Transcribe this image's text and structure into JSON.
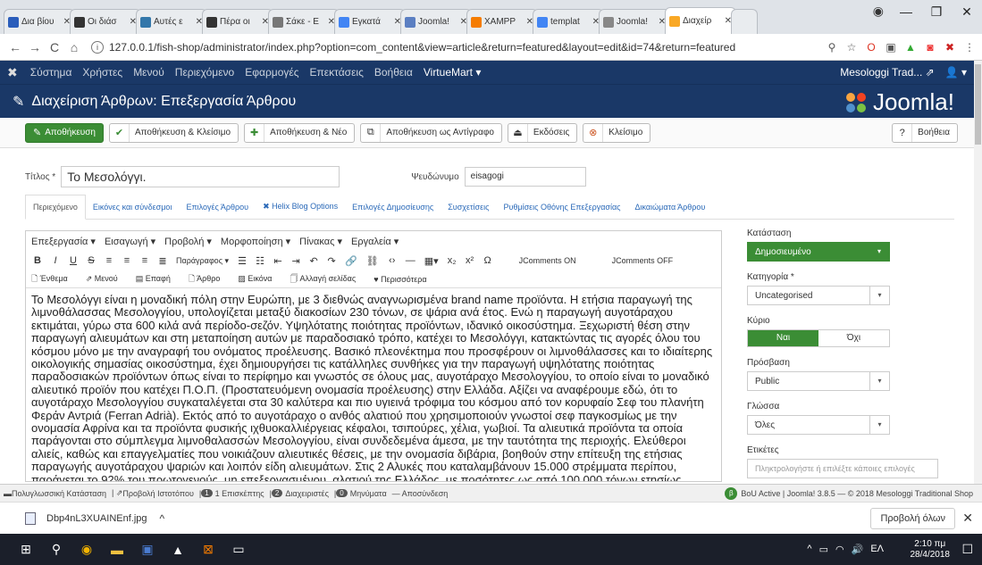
{
  "browser": {
    "tabs": [
      {
        "label": "Δια βίου",
        "color": "#2a5dbb"
      },
      {
        "label": "Οι διάσ",
        "color": "#333"
      },
      {
        "label": "Αυτές ε",
        "color": "#37a"
      },
      {
        "label": "Πέρα οι",
        "color": "#333"
      },
      {
        "label": "Σάκε - Ε",
        "color": "#777"
      },
      {
        "label": "Εγκατά",
        "color": "#4285f4"
      },
      {
        "label": "Joomla!",
        "color": "#5b7fc2"
      },
      {
        "label": "XAMPP",
        "color": "#f57c00"
      },
      {
        "label": "templat",
        "color": "#4285f4"
      },
      {
        "label": "Joomla!",
        "color": "#888"
      },
      {
        "label": "Διαχείρ",
        "color": "#f9a825"
      }
    ],
    "url": "127.0.0.1/fish-shop/administrator/index.php?option=com_content&view=article&return=featured&layout=edit&id=74&return=featured"
  },
  "topnav": {
    "items": [
      "Σύστημα",
      "Χρήστες",
      "Μενού",
      "Περιεχόμενο",
      "Εφαρμογές",
      "Επεκτάσεις",
      "Βοήθεια"
    ],
    "virtuemart": "VirtueMart ▾",
    "site": "Mesologgi Trad...",
    "site_icon": "external-link-icon",
    "user_icon": "user-icon"
  },
  "header": {
    "title": "Διαχείριση Άρθρων: Επεξεργασία Άρθρου",
    "logo": "Joomla!"
  },
  "toolbar": {
    "save": "Αποθήκευση",
    "save_close": "Αποθήκευση & Κλείσιμο",
    "save_new": "Αποθήκευση & Νέο",
    "save_copy": "Αποθήκευση ως Αντίγραφο",
    "versions": "Εκδόσεις",
    "close": "Κλείσιμο",
    "help": "Βοήθεια"
  },
  "form": {
    "title_label": "Τίτλος *",
    "title_value": "Το Μεσολόγγι.",
    "alias_label": "Ψευδώνυμο",
    "alias_value": "eisagogi"
  },
  "tabs": [
    "Περιεχόμενο",
    "Εικόνες και σύνδεσμοι",
    "Επιλογές Άρθρου",
    "Helix Blog Options",
    "Επιλογές Δημοσίευσης",
    "Συσχετίσεις",
    "Ρυθμίσεις Οθόνης Επεξεργασίας",
    "Δικαιώματα Άρθρου"
  ],
  "editor": {
    "menu": [
      "Επεξεργασία ▾",
      "Εισαγωγή ▾",
      "Προβολή ▾",
      "Μορφοποίηση ▾",
      "Πίνακας ▾",
      "Εργαλεία ▾"
    ],
    "paragraph": "Παράγραφος ▾",
    "jcomments_on": "JComments ON",
    "jcomments_off": "JComments OFF",
    "insert": [
      "Ένθεμα",
      "Μενού",
      "Επαφή",
      "Άρθρο",
      "Εικόνα",
      "Αλλαγή σελίδας",
      "Περισσότερα"
    ],
    "body": "Το Μεσολόγγι είναι η μοναδική πόλη στην Ευρώπη, με 3 διεθνώς αναγνωρισμένα brand name προϊόντα. Η ετήσια παραγωγή της λιμνοθάλασσας Μεσολογγίου, υπολογίζεται μεταξύ διακοσίων 230 τόνων, σε ψάρια ανά έτος. Ενώ η παραγωγή αυγοτάραχου εκτιμάται, γύρω στα 600 κιλά ανά περίοδο-σεζόν. Υψηλότατης ποιότητας προϊόντων, ιδανικό οικοσύστημα. Ξεχωριστή θέση στην παραγωγή αλιευμάτων και στη μεταποίηση αυτών με παραδοσιακό τρόπο, κατέχει το Μεσολόγγι, κατακτώντας τις αγορές όλου του κόσμου μόνο με την αναγραφή του ονόματος προέλευσης. Βασικό πλεονέκτημα που προσφέρουν οι λιμνοθάλασσες και το ιδιαίτερης οικολογικής σημασίας οικοσύστημα, έχει δημιουργήσει τις κατάλληλες συνθήκες για την παραγωγή υψηλότατης ποιότητας παραδοσιακών προϊόντων όπως είναι το περίφημο και γνωστός σε όλους μας, αυγοτάραχο Μεσολογγίου, το οποίο είναι το μοναδικό αλιευτικό προϊόν που κατέχει Π.Ο.Π. (Προστατευόμενη ονομασία προέλευσης) στην Ελλάδα. Αξίζει να αναφέρουμε εδώ, ότι το αυγοτάραχο Μεσολογγίου συγκαταλέγεται στα 30 καλύτερα και πιο υγιεινά τρόφιμα του κόσμου από τον κορυφαίο Σεφ του πλανήτη Φεράν Αντριά (Ferran Adrià). Εκτός από το αυγοτάραχο ο ανθός αλατιού που χρησιμοποιούν γνωστοί σεφ παγκοσμίως με την ονομασία Αφρίνα και τα προϊόντα φυσικής ιχθυοκαλλιέργειας κέφαλοι, τσιπούρες, χέλια, γωβιοί. Τα αλιευτικά προϊόντα τα οποία παράγονται στο σύμπλεγμα λιμνοθαλασσών Μεσολογγίου, είναι συνδεδεμένα άμεσα, με την ταυτότητα της περιοχής. Ελεύθεροι αλιείς, καθώς και επαγγελματίες που νοικιάζουν αλιευτικές θέσεις, με την ονομασία διβάρια, βοηθούν στην επίτευξη της ετήσιας παραγωγής αυγοτάραχου ψαριών και λοιπόν είδη αλιευμάτων. Στις 2 Αλυκές που καταλαμβάνουν 15.000 στρέμματα περίπου, παράγεται το 92% του πρωτογενούς, μη επεξεργασμένου, αλατιού της Ελλάδος, με ποσότητες ως από 100.000 τόνων ετησίως."
  },
  "sidebar": {
    "status_label": "Κατάσταση",
    "status_value": "Δημοσιευμένο",
    "category_label": "Κατηγορία *",
    "category_value": "Uncategorised",
    "featured_label": "Κύριο",
    "featured_yes": "Ναι",
    "featured_no": "Όχι",
    "access_label": "Πρόσβαση",
    "access_value": "Public",
    "language_label": "Γλώσσα",
    "language_value": "Όλες",
    "tags_label": "Ετικέτες",
    "tags_placeholder": "Πληκτρολογήστε ή επιλέξτε κάποιες επιλογές"
  },
  "statusbar": {
    "multilang": "Πολυγλωσσική Κατάσταση",
    "view_site": "Προβολή Ιστοτόπου",
    "visitors_count": "1",
    "visitors": "1 Επισκέπτης",
    "admins_count": "2",
    "admins": "Διαχειριστές",
    "messages_count": "0",
    "messages": "Μηνύματα",
    "logout": "— Αποσύνδεση",
    "bou": "BoU Active",
    "version": "Joomla! 3.8.5 — © 2018 Mesologgi Traditional Shop"
  },
  "downloads": {
    "file": "Dbp4nL3XUAINEnf.jpg",
    "show_all": "Προβολή όλων"
  },
  "taskbar": {
    "lang": "ΕΛ",
    "time": "2:10 πμ",
    "date": "28/4/2018"
  }
}
